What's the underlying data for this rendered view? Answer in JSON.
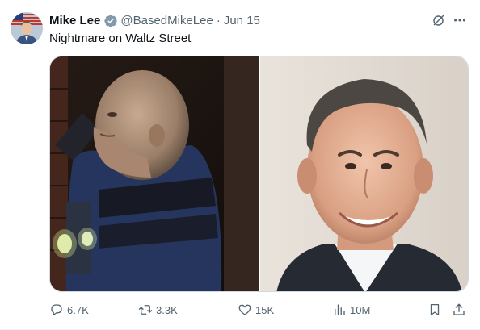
{
  "tweet": {
    "author_name": "Mike Lee",
    "author_handle": "@BasedMikeLee",
    "separator": "·",
    "date": "Jun 15",
    "text": "Nightmare on Waltz Street",
    "verified_icon": "verified-badge-icon",
    "grok_icon": "grok-icon",
    "more_icon": "more-horizontal-icon"
  },
  "media": {
    "left_image": "masked-figure-photo",
    "right_image": "smiling-man-portrait"
  },
  "actions": {
    "reply_count": "6.7K",
    "retweet_count": "3.3K",
    "like_count": "15K",
    "view_count": "10M",
    "icons": [
      "reply-icon",
      "retweet-icon",
      "like-icon",
      "views-icon",
      "bookmark-icon",
      "share-icon"
    ]
  },
  "colors": {
    "text_primary": "#0f1419",
    "text_secondary": "#536471",
    "verified_blue": "#829aab",
    "border": "#cfd9de"
  }
}
